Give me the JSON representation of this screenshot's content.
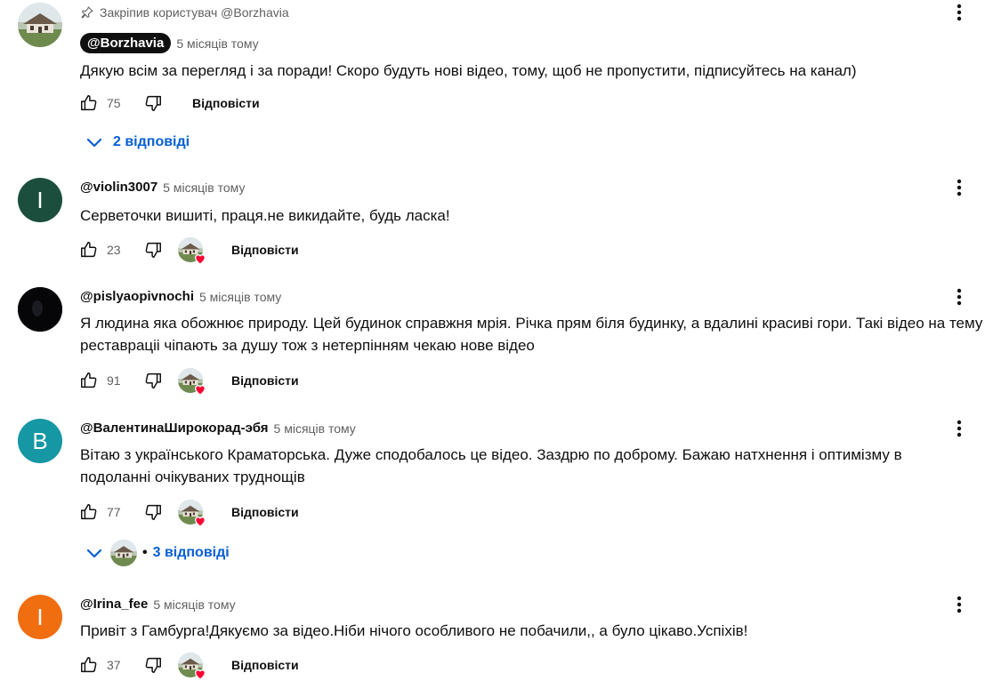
{
  "pinned_label": "Закріпив користувач @Borzhavia",
  "reply_label": "Відповісти",
  "colors": {
    "link": "#065fd4",
    "heart": "#ff0033"
  },
  "comments": [
    {
      "author": "@Borzhavia",
      "time": "5 місяців тому",
      "text": "Дякую всім за перегляд і за поради! Скоро будуть нові відео, тому, щоб не пропустити, підписуйтесь на канал)",
      "likes": "75",
      "replies": "2 відповіді",
      "avatar_icon": "house-photo-avatar"
    },
    {
      "author": "@violin3007",
      "time": "5 місяців тому",
      "text": "Серветочки вишиті, праця.не викидайте, будь ласка!",
      "likes": "23",
      "avatar_letter": "I",
      "avatar_color": "#1c4e3e"
    },
    {
      "author": "@pislyaopivnochi",
      "time": "5 місяців тому",
      "text": "Я людина яка обожнює природу. Цей будинок справжня мрія. Річка прям біля будинку, а вдалині красиві гори. Такі відео на тему реставраціі чіпають за душу тож з нетерпінням чекаю нове відео",
      "likes": "91",
      "avatar_icon": "dark-photo-avatar"
    },
    {
      "author": "@ВалентинаШирокорад-эбя",
      "time": "5 місяців тому",
      "text": "Вітаю з українського Краматорська. Дуже сподобалось це відео. Заздрю по доброму. Бажаю натхнення і оптимізму в подоланні очікуваних труднощів",
      "likes": "77",
      "replies": "3 відповіді",
      "avatar_letter": "B",
      "avatar_color": "#1597a4"
    },
    {
      "author": "@Irina_fee",
      "time": "5 місяців тому",
      "text": "Привіт з Гамбурга!Дякуємо за відео.Ніби нічого особливого не побачили,, а було цікаво.Успіхів!",
      "likes": "37",
      "avatar_letter": "I",
      "avatar_color": "#f06d10"
    }
  ]
}
